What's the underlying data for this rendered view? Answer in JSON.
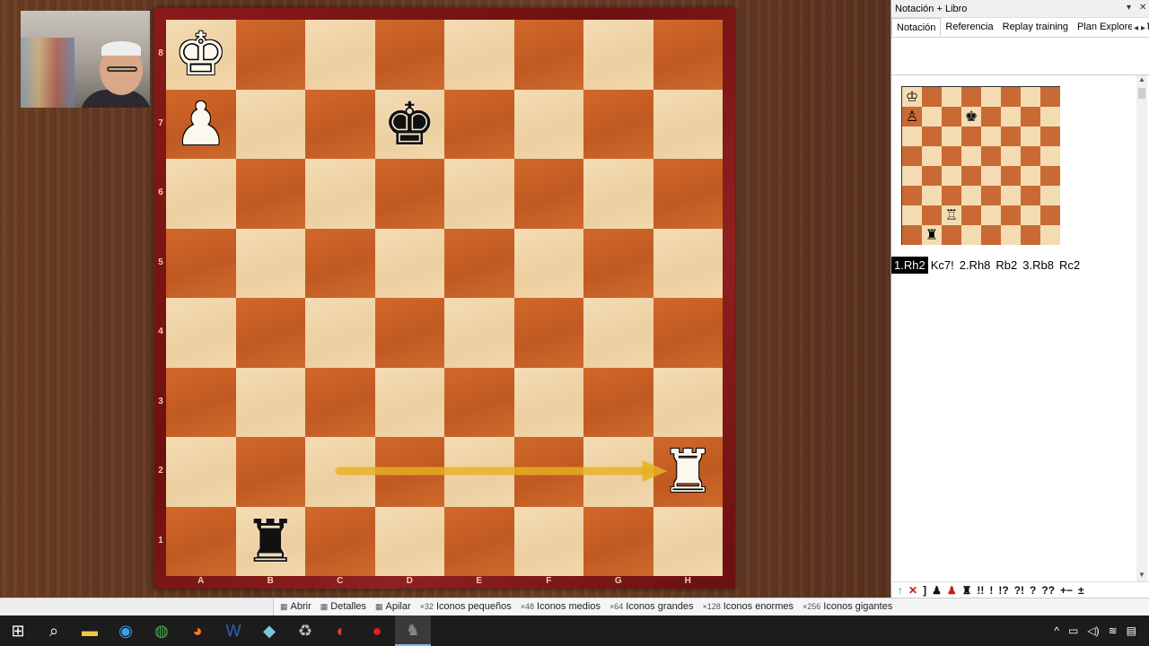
{
  "panel": {
    "title": "Notación + Libro",
    "tabs": [
      "Notación",
      "Referencia",
      "Replay training",
      "Plan Explorer",
      "T"
    ]
  },
  "board": {
    "ranks": [
      "8",
      "7",
      "6",
      "5",
      "4",
      "3",
      "2",
      "1"
    ],
    "files": [
      "A",
      "B",
      "C",
      "D",
      "E",
      "F",
      "G",
      "H"
    ],
    "pieces": [
      {
        "glyph": "♚",
        "color": "white",
        "square": "a8",
        "name": "white-king"
      },
      {
        "glyph": "♟",
        "color": "white",
        "square": "a7",
        "name": "white-pawn"
      },
      {
        "glyph": "♚",
        "color": "black",
        "square": "d7",
        "name": "black-king"
      },
      {
        "glyph": "♜",
        "color": "white",
        "square": "h2",
        "name": "white-rook"
      },
      {
        "glyph": "♜",
        "color": "black",
        "square": "b1",
        "name": "black-rook"
      }
    ],
    "arrow": {
      "from": "c2",
      "to": "h2",
      "color": "#e8b020"
    }
  },
  "mini_board": {
    "pieces": [
      {
        "glyph": "♔",
        "square": "a8"
      },
      {
        "glyph": "♙",
        "square": "a7"
      },
      {
        "glyph": "♚",
        "square": "d7"
      },
      {
        "glyph": "♖",
        "square": "c2"
      },
      {
        "glyph": "♜",
        "square": "b1"
      }
    ]
  },
  "moves": [
    "1.Rh2",
    "Kc7!",
    "2.Rh8",
    "Rb2",
    "3.Rb8",
    "Rc2"
  ],
  "current_move": 0,
  "annotations": [
    "↑",
    "✕",
    "]",
    "♟",
    "♟",
    "♜",
    "!!",
    "!",
    "!?",
    "?!",
    "?",
    "??",
    "+−",
    "±"
  ],
  "explorer": {
    "items": [
      "Abrir",
      "Detalles",
      "Apilar",
      "Iconos pequeños",
      "Iconos medios",
      "Iconos grandes",
      "Iconos enormes",
      "Iconos gigantes"
    ],
    "badges": [
      "",
      "",
      "",
      "×32",
      "×48",
      "×64",
      "×128",
      "×256"
    ]
  },
  "taskbar": {
    "icons": [
      "windows-start-icon",
      "search-icon",
      "file-explorer-icon",
      "edge-icon",
      "chrome-icon",
      "firefox-icon",
      "word-icon",
      "app-icon",
      "recycle-icon",
      "app-red-icon",
      "record-icon",
      "chessbase-icon"
    ]
  },
  "colors": {
    "light_square": "#f4dcb4",
    "dark_square": "#c96a34",
    "frame": "#7a1515",
    "arrow": "#e8b020"
  }
}
